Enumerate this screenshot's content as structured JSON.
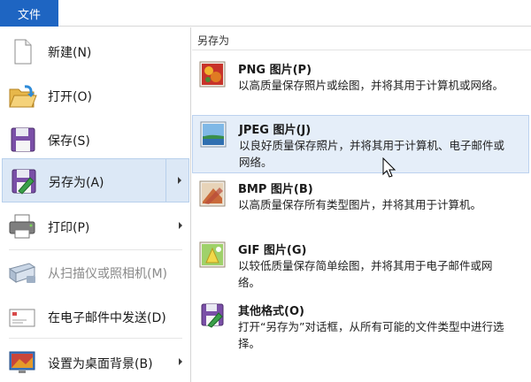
{
  "menu": {
    "file_tab_label": "文件"
  },
  "left_menu": {
    "items": [
      {
        "key": "new",
        "label": "新建(N)"
      },
      {
        "key": "open",
        "label": "打开(O)"
      },
      {
        "key": "save",
        "label": "保存(S)"
      },
      {
        "key": "save_as",
        "label": "另存为(A)",
        "selected": true,
        "has_submenu": true
      },
      {
        "key": "print",
        "label": "打印(P)",
        "has_submenu": true
      },
      {
        "key": "scan",
        "label": "从扫描仪或照相机(M)",
        "disabled": true
      },
      {
        "key": "email",
        "label": "在电子邮件中发送(D)"
      },
      {
        "key": "wallpaper",
        "label": "设置为桌面背景(B)",
        "has_submenu": true
      }
    ]
  },
  "save_as_panel": {
    "header": "另存为",
    "options": [
      {
        "key": "png",
        "title": "PNG 图片(P)",
        "desc": "以高质量保存照片或绘图，并将其用于计算机或网络。"
      },
      {
        "key": "jpeg",
        "title": "JPEG 图片(J)",
        "desc": "以良好质量保存照片，并将其用于计算机、电子邮件或网络。",
        "hover": true
      },
      {
        "key": "bmp",
        "title": "BMP 图片(B)",
        "desc": "以高质量保存所有类型图片，并将其用于计算机。"
      },
      {
        "key": "gif",
        "title": "GIF 图片(G)",
        "desc": "以较低质量保存简单绘图，并将其用于电子邮件或网络。"
      },
      {
        "key": "other",
        "title": "其他格式(O)",
        "desc": "打开“另存为”对话框，从所有可能的文件类型中进行选择。"
      }
    ]
  },
  "colors": {
    "accent": "#1e65c2",
    "selected_bg": "#dce8f6",
    "hover_bg": "#e5eef9"
  }
}
